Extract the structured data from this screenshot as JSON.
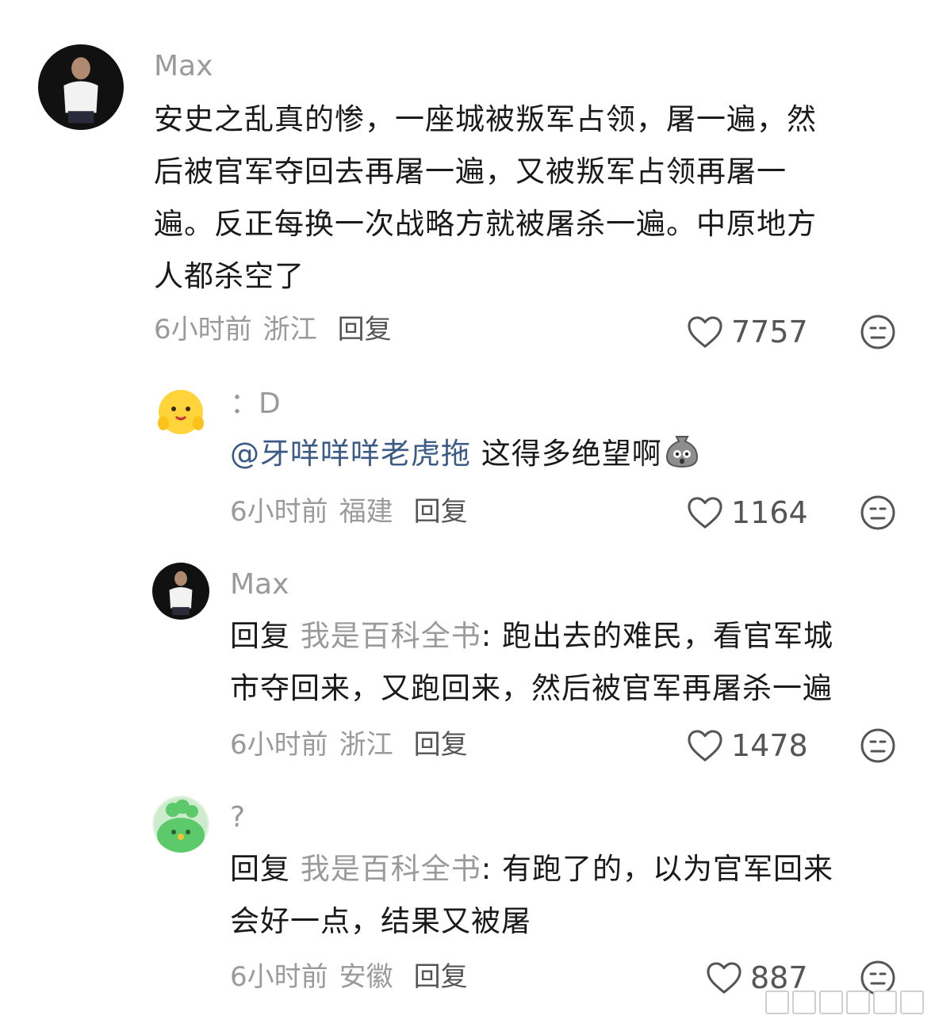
{
  "comments": [
    {
      "username": "Max",
      "text": "安史之乱真的惨，一座城被叛军占领，屠一遍，然\n后被官军夺回去再屠一遍，又被叛军占领再屠一\n遍。反正每换一次战略方就被屠杀一遍。中原地方\n人都杀空了",
      "time": "6小时前",
      "location": "浙江",
      "reply_label": "回复",
      "likes": "7757"
    },
    {
      "username": "：D",
      "mention": "@牙咩咩咩老虎拖",
      "text": " 这得多绝望啊",
      "time": "6小时前",
      "location": "福建",
      "reply_label": "回复",
      "likes": "1164"
    },
    {
      "username": "Max",
      "reply_prefix": "回复 ",
      "reply_target": "我是百科全书",
      "text": ": 跑出去的难民，看官军城\n市夺回来，又跑回来，然后被官军再屠杀一遍",
      "time": "6小时前",
      "location": "浙江",
      "reply_label": "回复",
      "likes": "1478"
    },
    {
      "username": "?",
      "reply_prefix": "回复 ",
      "reply_target": "我是百科全书",
      "text": ": 有跑了的，以为官军回来\n会好一点，结果又被屠",
      "time": "6小时前",
      "location": "安徽",
      "reply_label": "回复",
      "likes": "887"
    }
  ],
  "icons": {
    "like": "heart-outline-icon",
    "dislike": "meh-face-icon",
    "inline_emoji": "shocked-sack-emoji"
  },
  "colors": {
    "username": "#9a9a9a",
    "mention": "#3b5a85",
    "text": "#1a1a1a"
  }
}
